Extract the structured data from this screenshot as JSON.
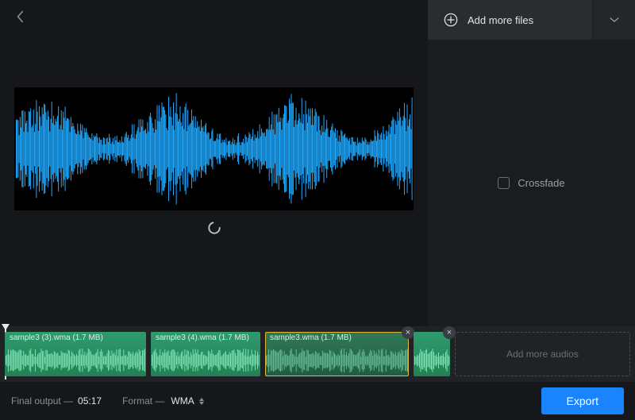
{
  "sidebar": {
    "add_files_label": "Add more files",
    "crossfade_label": "Crossfade"
  },
  "timeline": {
    "clips": [
      {
        "label": "sample3 (3).wma (1.7 MB)"
      },
      {
        "label": "sample3 (4).wma (1.7 MB)"
      },
      {
        "label": "sample3.wma (1.7 MB)"
      },
      {
        "label": ""
      }
    ],
    "add_more_label": "Add more audios"
  },
  "footer": {
    "final_output_label": "Final output —",
    "final_output_time": "05:17",
    "format_label": "Format —",
    "format_value": "WMA",
    "export_label": "Export"
  },
  "icons": {
    "back": "chevron-left",
    "plus": "plus-circle",
    "expand": "chevron-down",
    "close": "×"
  }
}
